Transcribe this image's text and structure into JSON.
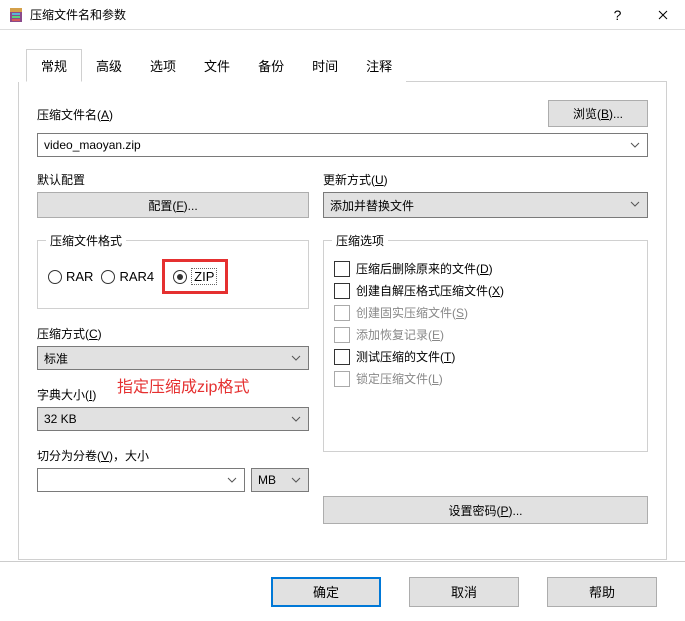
{
  "title": "压缩文件名和参数",
  "tabs": [
    "常规",
    "高级",
    "选项",
    "文件",
    "备份",
    "时间",
    "注释"
  ],
  "archive_name": {
    "label_pre": "压缩文件名(",
    "accel": "A",
    "label_post": ")",
    "value": "video_maoyan.zip"
  },
  "browse": {
    "pre": "浏览(",
    "accel": "B",
    "post": ")..."
  },
  "profile": {
    "label": "默认配置",
    "button_pre": "配置(",
    "accel": "F",
    "button_post": ")..."
  },
  "update_mode": {
    "label_pre": "更新方式(",
    "accel": "U",
    "label_post": ")",
    "value": "添加并替换文件"
  },
  "format": {
    "legend": "压缩文件格式",
    "options": [
      "RAR",
      "RAR4",
      "ZIP"
    ],
    "selected": "ZIP"
  },
  "method": {
    "label_pre": "压缩方式(",
    "accel": "C",
    "label_post": ")",
    "value": "标准"
  },
  "dict": {
    "label_pre": "字典大小(",
    "accel": "I",
    "label_post": ")",
    "value": "32 KB"
  },
  "split": {
    "label_pre": "切分为分卷(",
    "accel": "V",
    "label_post": ")，大小",
    "value": "",
    "unit": "MB"
  },
  "options_group": {
    "legend": "压缩选项",
    "items": [
      {
        "pre": "压缩后删除原来的文件(",
        "accel": "D",
        "post": ")",
        "disabled": false
      },
      {
        "pre": "创建自解压格式压缩文件(",
        "accel": "X",
        "post": ")",
        "disabled": false
      },
      {
        "pre": "创建固实压缩文件(",
        "accel": "S",
        "post": ")",
        "disabled": true
      },
      {
        "pre": "添加恢复记录(",
        "accel": "E",
        "post": ")",
        "disabled": true
      },
      {
        "pre": "测试压缩的文件(",
        "accel": "T",
        "post": ")",
        "disabled": false
      },
      {
        "pre": "锁定压缩文件(",
        "accel": "L",
        "post": ")",
        "disabled": true
      }
    ]
  },
  "password": {
    "pre": "设置密码(",
    "accel": "P",
    "post": ")..."
  },
  "annotation": "指定压缩成zip格式",
  "footer": {
    "ok": "确定",
    "cancel": "取消",
    "help": "帮助"
  }
}
